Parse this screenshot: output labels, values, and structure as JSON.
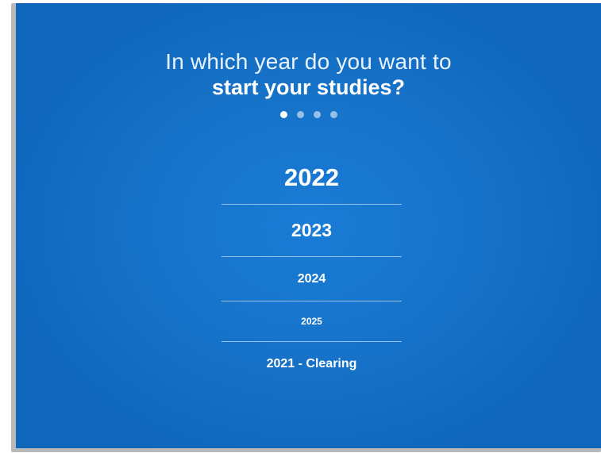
{
  "question": {
    "line1": "In which year do you want to",
    "line2": "start your studies?"
  },
  "progress": {
    "total_steps": 4,
    "current_step": 1
  },
  "options": [
    {
      "label": "2022"
    },
    {
      "label": "2023"
    },
    {
      "label": "2024"
    },
    {
      "label": "2025"
    },
    {
      "label": "2021 - Clearing"
    }
  ],
  "colors": {
    "background": "#1672c8",
    "text": "#ffffff",
    "divider": "rgba(255,255,255,0.55)"
  }
}
